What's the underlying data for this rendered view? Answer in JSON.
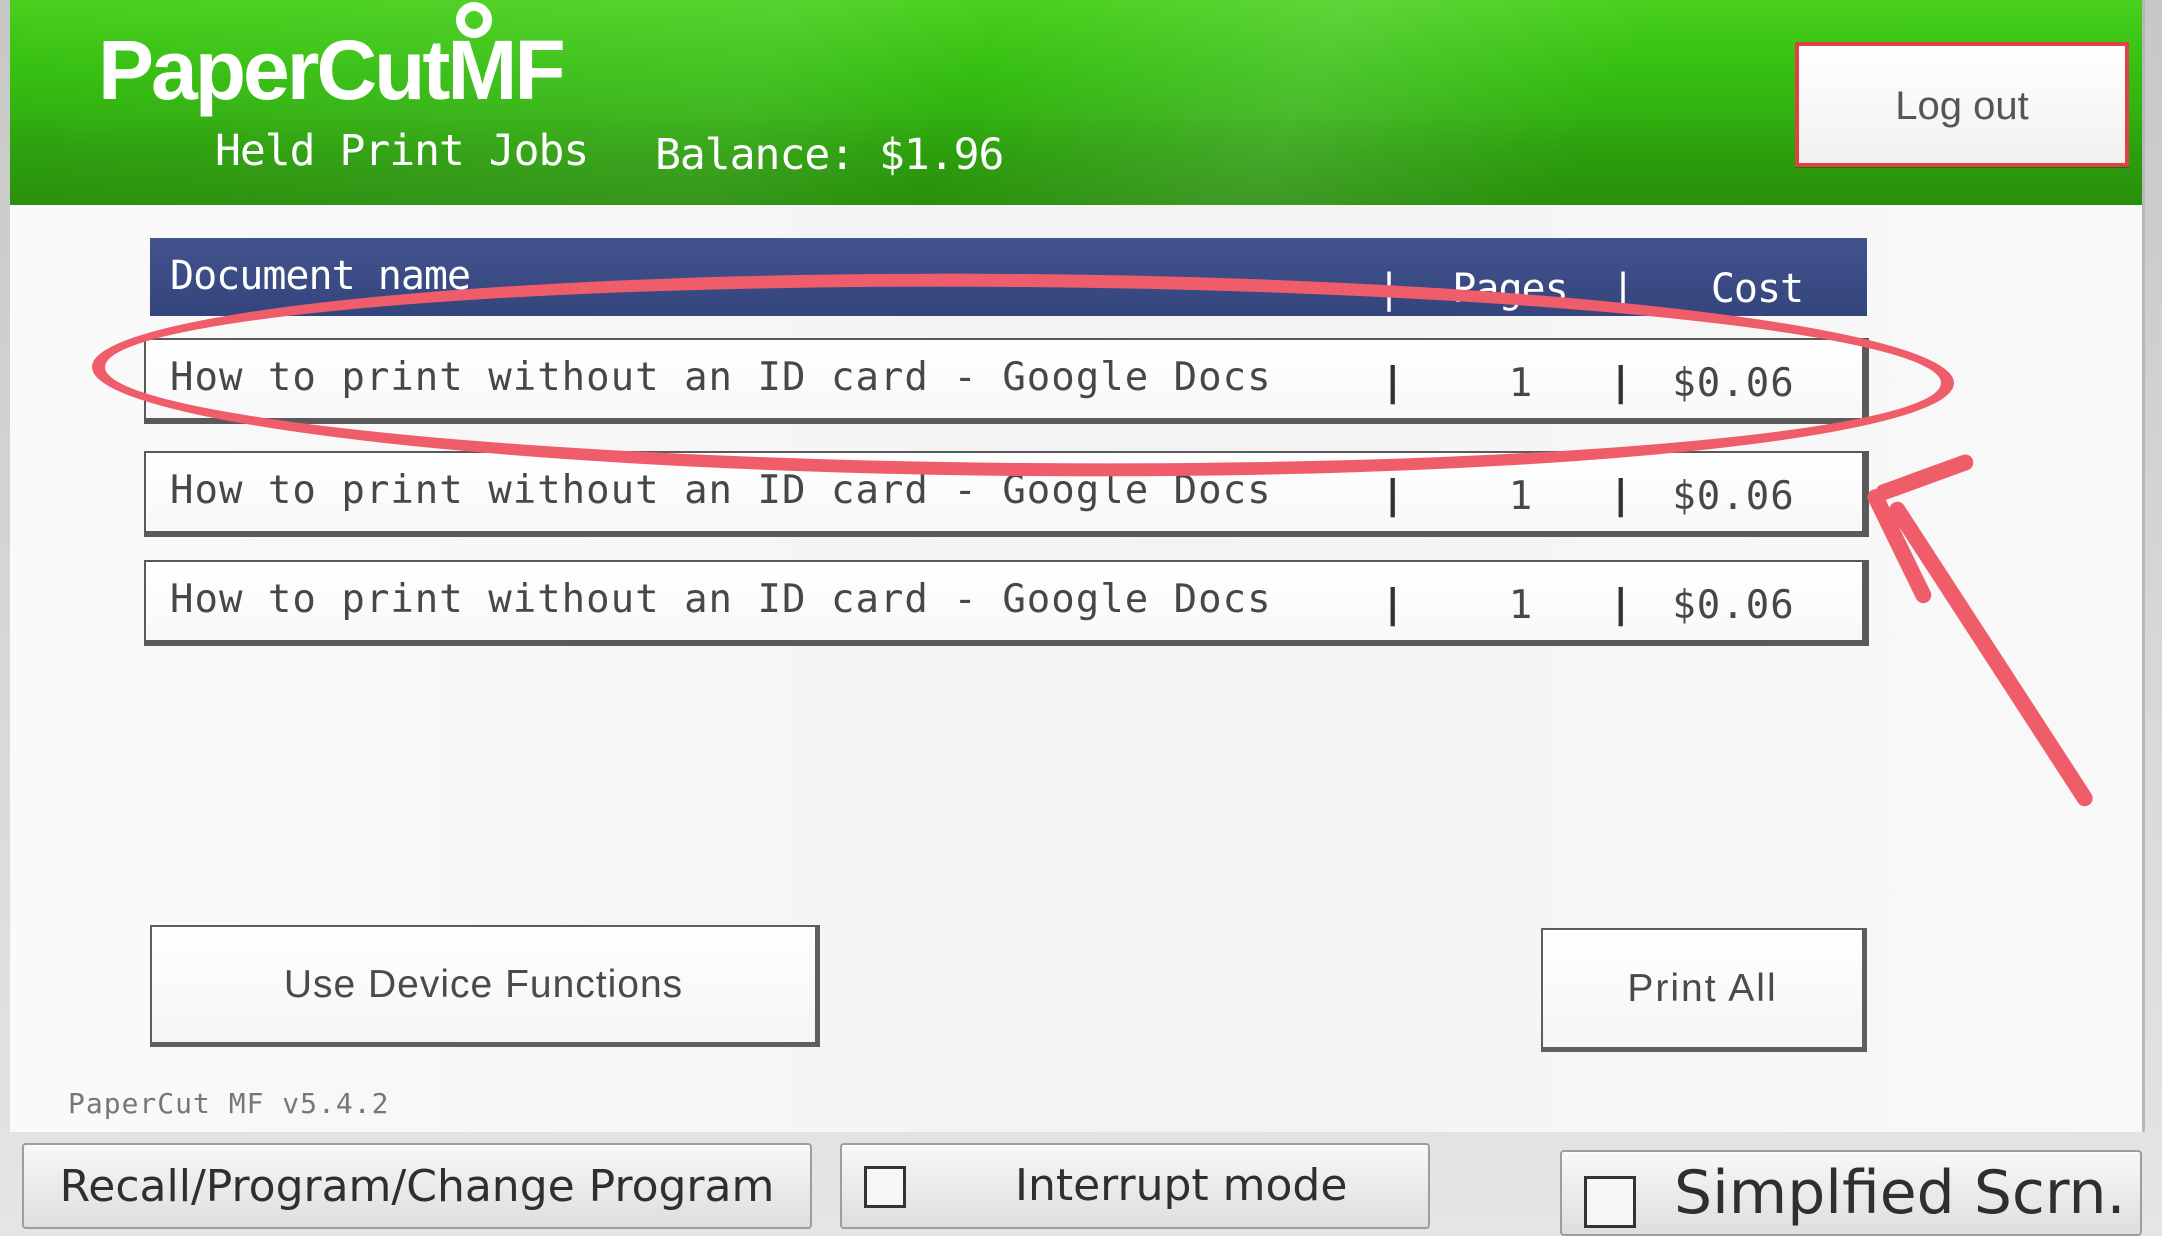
{
  "app": {
    "brand": "PaperCut",
    "brand_suffix": "MF",
    "section_title": "Held Print Jobs",
    "balance": "Balance: $1.96",
    "logout_label": "Log out",
    "version": "PaperCut MF v5.4.2"
  },
  "table": {
    "headers": {
      "document": "Document name",
      "pages": "Pages",
      "cost": "Cost",
      "separator": "|"
    },
    "rows": [
      {
        "document": "How to print without an ID card - Google Docs",
        "pages": "1",
        "cost": "$0.06"
      },
      {
        "document": "How to print without an ID card - Google Docs",
        "pages": "1",
        "cost": "$0.06"
      },
      {
        "document": "How to print without an ID card - Google Docs",
        "pages": "1",
        "cost": "$0.06"
      }
    ]
  },
  "actions": {
    "device_functions": "Use Device Functions",
    "print_all": "Print All"
  },
  "bottom_bar": {
    "recall": "Recall/Program/Change Program",
    "interrupt": "Interrupt mode",
    "simplified": "Simplfied Scrn."
  },
  "colors": {
    "header_green": "#35be11",
    "table_header_blue": "#3b4b86",
    "annotation_pink": "#ef5d6b",
    "logout_red": "#df4242"
  },
  "icons": {
    "annotation_oval": "highlight-oval-icon",
    "annotation_arrow": "annotation-arrow-icon",
    "checkbox": "checkbox-icon"
  }
}
